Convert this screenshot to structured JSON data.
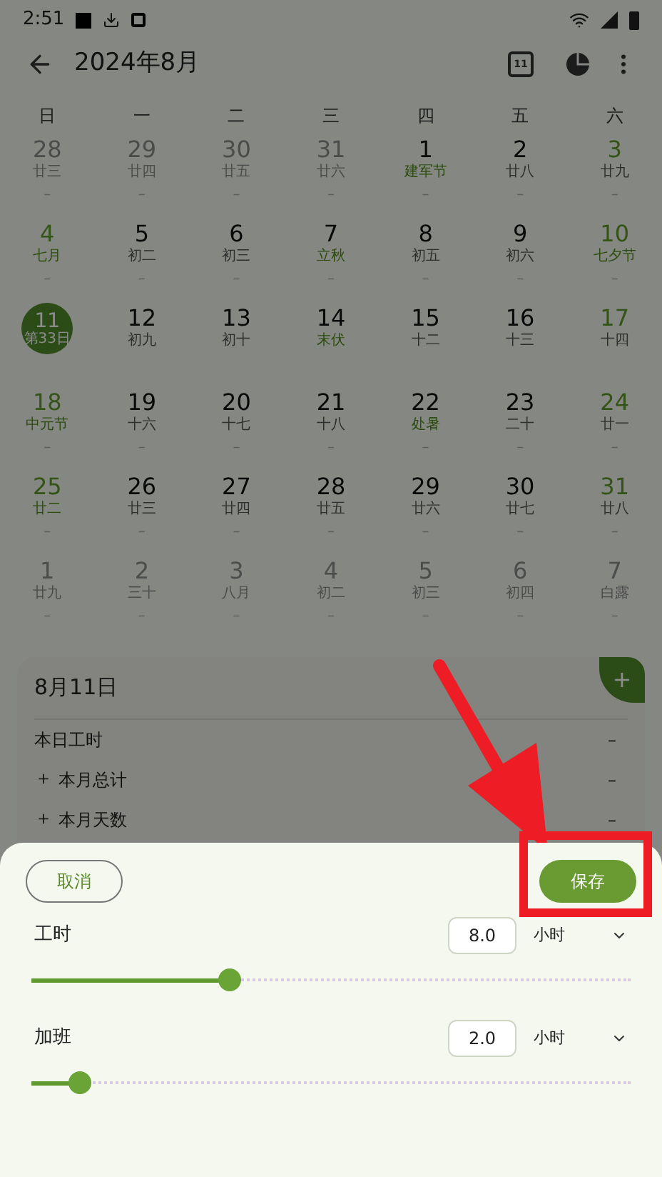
{
  "status_bar": {
    "time": "2:51"
  },
  "toolbar": {
    "title": "2024年8月",
    "calendar_day": "11"
  },
  "weekdays": [
    "日",
    "一",
    "二",
    "三",
    "四",
    "五",
    "六"
  ],
  "weeks": [
    [
      {
        "day": "28",
        "lunar": "廿三",
        "in_month": false,
        "festival": false,
        "selected": false,
        "mark": "–"
      },
      {
        "day": "29",
        "lunar": "廿四",
        "in_month": false,
        "festival": false,
        "selected": false,
        "mark": "–"
      },
      {
        "day": "30",
        "lunar": "廿五",
        "in_month": false,
        "festival": false,
        "selected": false,
        "mark": "–"
      },
      {
        "day": "31",
        "lunar": "廿六",
        "in_month": false,
        "festival": false,
        "selected": false,
        "mark": "–"
      },
      {
        "day": "1",
        "lunar": "建军节",
        "in_month": true,
        "festival": true,
        "selected": false,
        "mark": "–"
      },
      {
        "day": "2",
        "lunar": "廿八",
        "in_month": true,
        "festival": false,
        "selected": false,
        "mark": "–"
      },
      {
        "day": "3",
        "lunar": "廿九",
        "in_month": true,
        "festival": false,
        "selected": false,
        "mark": "–"
      }
    ],
    [
      {
        "day": "4",
        "lunar": "七月",
        "in_month": true,
        "festival": true,
        "selected": false,
        "mark": "–"
      },
      {
        "day": "5",
        "lunar": "初二",
        "in_month": true,
        "festival": false,
        "selected": false,
        "mark": "–"
      },
      {
        "day": "6",
        "lunar": "初三",
        "in_month": true,
        "festival": false,
        "selected": false,
        "mark": "–"
      },
      {
        "day": "7",
        "lunar": "立秋",
        "in_month": true,
        "festival": true,
        "selected": false,
        "mark": "–"
      },
      {
        "day": "8",
        "lunar": "初五",
        "in_month": true,
        "festival": false,
        "selected": false,
        "mark": "–"
      },
      {
        "day": "9",
        "lunar": "初六",
        "in_month": true,
        "festival": false,
        "selected": false,
        "mark": "–"
      },
      {
        "day": "10",
        "lunar": "七夕节",
        "in_month": true,
        "festival": true,
        "selected": false,
        "mark": "–"
      }
    ],
    [
      {
        "day": "11",
        "lunar": "第33日",
        "in_month": true,
        "festival": false,
        "selected": true
      },
      {
        "day": "12",
        "lunar": "初九",
        "in_month": true,
        "festival": false,
        "selected": false
      },
      {
        "day": "13",
        "lunar": "初十",
        "in_month": true,
        "festival": false,
        "selected": false
      },
      {
        "day": "14",
        "lunar": "末伏",
        "in_month": true,
        "festival": true,
        "selected": false
      },
      {
        "day": "15",
        "lunar": "十二",
        "in_month": true,
        "festival": false,
        "selected": false
      },
      {
        "day": "16",
        "lunar": "十三",
        "in_month": true,
        "festival": false,
        "selected": false
      },
      {
        "day": "17",
        "lunar": "十四",
        "in_month": true,
        "festival": false,
        "selected": false
      }
    ],
    [
      {
        "day": "18",
        "lunar": "中元节",
        "in_month": true,
        "festival": true,
        "selected": false,
        "mark": "–"
      },
      {
        "day": "19",
        "lunar": "十六",
        "in_month": true,
        "festival": false,
        "selected": false,
        "mark": "–"
      },
      {
        "day": "20",
        "lunar": "十七",
        "in_month": true,
        "festival": false,
        "selected": false,
        "mark": "–"
      },
      {
        "day": "21",
        "lunar": "十八",
        "in_month": true,
        "festival": false,
        "selected": false,
        "mark": "–"
      },
      {
        "day": "22",
        "lunar": "处暑",
        "in_month": true,
        "festival": true,
        "selected": false,
        "mark": "–"
      },
      {
        "day": "23",
        "lunar": "二十",
        "in_month": true,
        "festival": false,
        "selected": false,
        "mark": "–"
      },
      {
        "day": "24",
        "lunar": "廿一",
        "in_month": true,
        "festival": false,
        "selected": false,
        "mark": "–"
      }
    ],
    [
      {
        "day": "25",
        "lunar": "廿二",
        "in_month": true,
        "festival": true,
        "selected": false,
        "mark": "–"
      },
      {
        "day": "26",
        "lunar": "廿三",
        "in_month": true,
        "festival": false,
        "selected": false,
        "mark": "–"
      },
      {
        "day": "27",
        "lunar": "廿四",
        "in_month": true,
        "festival": false,
        "selected": false,
        "mark": "–"
      },
      {
        "day": "28",
        "lunar": "廿五",
        "in_month": true,
        "festival": false,
        "selected": false,
        "mark": "–"
      },
      {
        "day": "29",
        "lunar": "廿六",
        "in_month": true,
        "festival": false,
        "selected": false,
        "mark": "–"
      },
      {
        "day": "30",
        "lunar": "廿七",
        "in_month": true,
        "festival": false,
        "selected": false,
        "mark": "–"
      },
      {
        "day": "31",
        "lunar": "廿八",
        "in_month": true,
        "festival": false,
        "selected": false,
        "mark": "–"
      }
    ],
    [
      {
        "day": "1",
        "lunar": "廿九",
        "in_month": false,
        "festival": false,
        "selected": false,
        "mark": "–"
      },
      {
        "day": "2",
        "lunar": "三十",
        "in_month": false,
        "festival": false,
        "selected": false,
        "mark": "–"
      },
      {
        "day": "3",
        "lunar": "八月",
        "in_month": false,
        "festival": false,
        "selected": false,
        "mark": "–"
      },
      {
        "day": "4",
        "lunar": "初二",
        "in_month": false,
        "festival": false,
        "selected": false,
        "mark": "–"
      },
      {
        "day": "5",
        "lunar": "初三",
        "in_month": false,
        "festival": false,
        "selected": false,
        "mark": "–"
      },
      {
        "day": "6",
        "lunar": "初四",
        "in_month": false,
        "festival": false,
        "selected": false,
        "mark": "–"
      },
      {
        "day": "7",
        "lunar": "白露",
        "in_month": false,
        "festival": false,
        "selected": false,
        "mark": "–"
      }
    ]
  ],
  "day_card": {
    "title": "8月11日",
    "add": "+",
    "rows": [
      {
        "prefix": "",
        "label": "本日工时",
        "value": "–"
      },
      {
        "prefix": "＋",
        "label": "本月总计",
        "value": "–"
      },
      {
        "prefix": "＋",
        "label": "本月天数",
        "value": "–"
      }
    ]
  },
  "sheet": {
    "cancel": "取消",
    "save": "保存",
    "rows": [
      {
        "label": "工时",
        "value": "8.0",
        "unit": "小时",
        "level": 0.33
      },
      {
        "label": "加班",
        "value": "2.0",
        "unit": "小时",
        "level": 0.08
      }
    ]
  }
}
